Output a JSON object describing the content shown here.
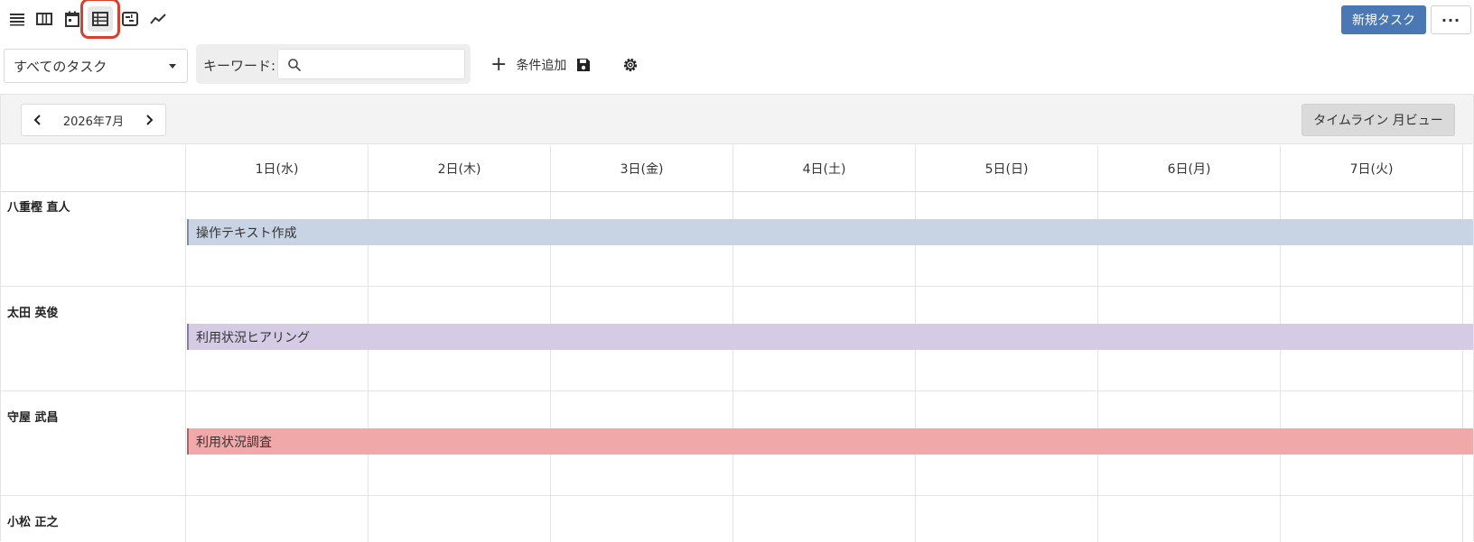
{
  "toolbar": {
    "view_icons": [
      "list-view-icon",
      "board-view-icon",
      "calendar-view-icon",
      "timeline-view-icon",
      "gantt-view-icon",
      "chart-view-icon"
    ],
    "new_task_label": "新規タスク",
    "more_label": "···"
  },
  "filter": {
    "selected": "すべてのタスク",
    "keyword_label": "キーワード:",
    "keyword_value": "",
    "add_condition_label": "条件追加"
  },
  "timeline": {
    "month_label": "2026年7月",
    "view_button_label": "タイムライン 月ビュー",
    "days": [
      "1日(水)",
      "2日(木)",
      "3日(金)",
      "4日(土)",
      "5日(日)",
      "6日(月)",
      "7日(火)"
    ],
    "rows": [
      {
        "person": "八重樫 直人",
        "task": "操作テキスト作成",
        "color": "#c8d4e4",
        "border": "#7b8ea8"
      },
      {
        "person": "太田 英俊",
        "task": "利用状況ヒアリング",
        "color": "#d5cbe4",
        "border": "#8a7aa4"
      },
      {
        "person": "守屋 武昌",
        "task": "利用状況調査",
        "color": "#f0a8a8",
        "border": "#b56060"
      },
      {
        "person": "小松 正之",
        "task": "",
        "color": "",
        "border": ""
      }
    ]
  },
  "colors": {
    "primary": "#4a78b4",
    "highlight_ring": "#d9402b"
  }
}
